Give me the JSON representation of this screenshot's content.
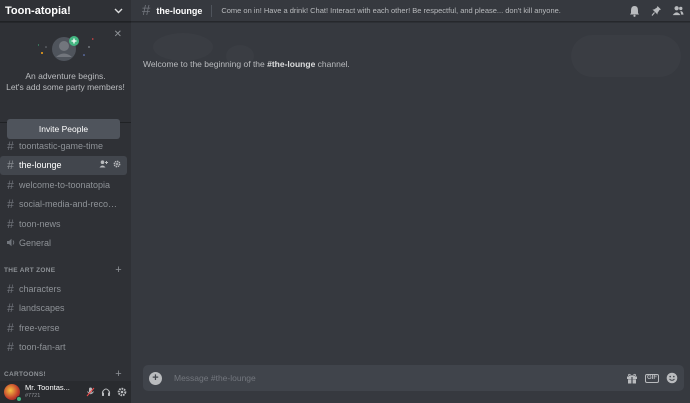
{
  "server": {
    "name": "Toon-atopia!"
  },
  "invite": {
    "line1": "An adventure begins.",
    "line2": "Let's add some party members!",
    "button": "Invite People"
  },
  "channels": [
    {
      "label": "toontastic-game-time",
      "type": "text",
      "active": false
    },
    {
      "label": "the-lounge",
      "type": "text",
      "active": true
    },
    {
      "label": "welcome-to-toonatopia",
      "type": "text",
      "active": false
    },
    {
      "label": "social-media-and-recom...",
      "type": "text",
      "active": false
    },
    {
      "label": "toon-news",
      "type": "text",
      "active": false
    },
    {
      "label": "General",
      "type": "voice",
      "active": false
    }
  ],
  "categories": [
    {
      "name": "THE ART ZONE",
      "channels": [
        {
          "label": "characters"
        },
        {
          "label": "landscapes"
        },
        {
          "label": "free-verse"
        },
        {
          "label": "toon-fan-art"
        }
      ]
    },
    {
      "name": "CARTOONS!",
      "channels": []
    }
  ],
  "user": {
    "name": "Mr. Toontas...",
    "tag": "#7721",
    "status_color": "#43b581"
  },
  "header": {
    "channel": "the-lounge",
    "topic": "Come on in! Have a drink! Chat! Interact with each other! Be respectful, and please... don't kill anyone."
  },
  "welcome": {
    "prefix": "Welcome to the beginning of the ",
    "channel": "#the-lounge",
    "suffix": " channel."
  },
  "composer": {
    "placeholder": "Message #the-lounge",
    "gif_label": "GIF"
  },
  "colors": {
    "accent": "#7289da",
    "status_online": "#43b581",
    "invite_badge": "#43b581"
  }
}
